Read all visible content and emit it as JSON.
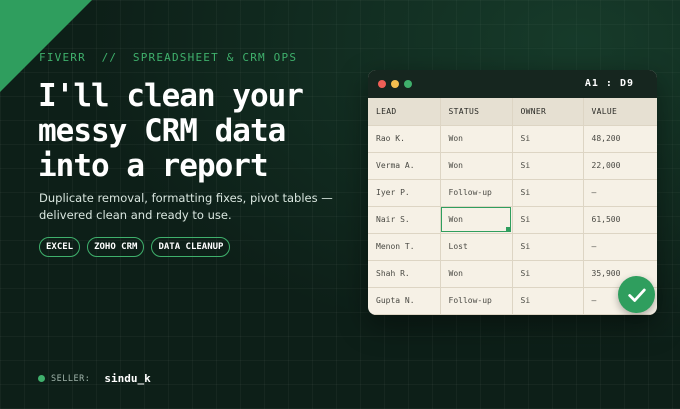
{
  "eyebrow": "FIVERR  //  SPREADSHEET & CRM OPS",
  "headline": [
    "I'll clean your",
    "messy CRM data",
    "into a report"
  ],
  "subtitle": "Duplicate removal, formatting fixes, pivot tables — delivered clean and ready to use.",
  "tags": [
    "EXCEL",
    "ZOHO CRM",
    "DATA CLEANUP"
  ],
  "seller": {
    "label": "SELLER:",
    "name": "sindu_k"
  },
  "spreadsheet": {
    "cell_ref": "A1 : D9",
    "window_dots": [
      "#ef5f57",
      "#f4bf4f",
      "#3fb06c"
    ],
    "columns": [
      "LEAD",
      "STATUS",
      "OWNER",
      "VALUE"
    ],
    "rows": [
      [
        "Rao K.",
        "Won",
        "Si",
        "48,200"
      ],
      [
        "Verma A.",
        "Won",
        "Si",
        "22,000"
      ],
      [
        "Iyer P.",
        "Follow-up",
        "Si",
        "—"
      ],
      [
        "Nair S.",
        "Won",
        "Si",
        "61,500"
      ],
      [
        "Menon T.",
        "Lost",
        "Si",
        "—"
      ],
      [
        "Shah R.",
        "Won",
        "Si",
        "35,900"
      ],
      [
        "Gupta N.",
        "Follow-up",
        "Si",
        "—"
      ]
    ],
    "selected_cell": {
      "row": 3,
      "col": 1
    }
  },
  "colors": {
    "accent": "#2f9e5e",
    "background": "#0d1f18",
    "sheet": "#f6f1e6"
  },
  "icons": {
    "badge": "checkmark-icon"
  }
}
